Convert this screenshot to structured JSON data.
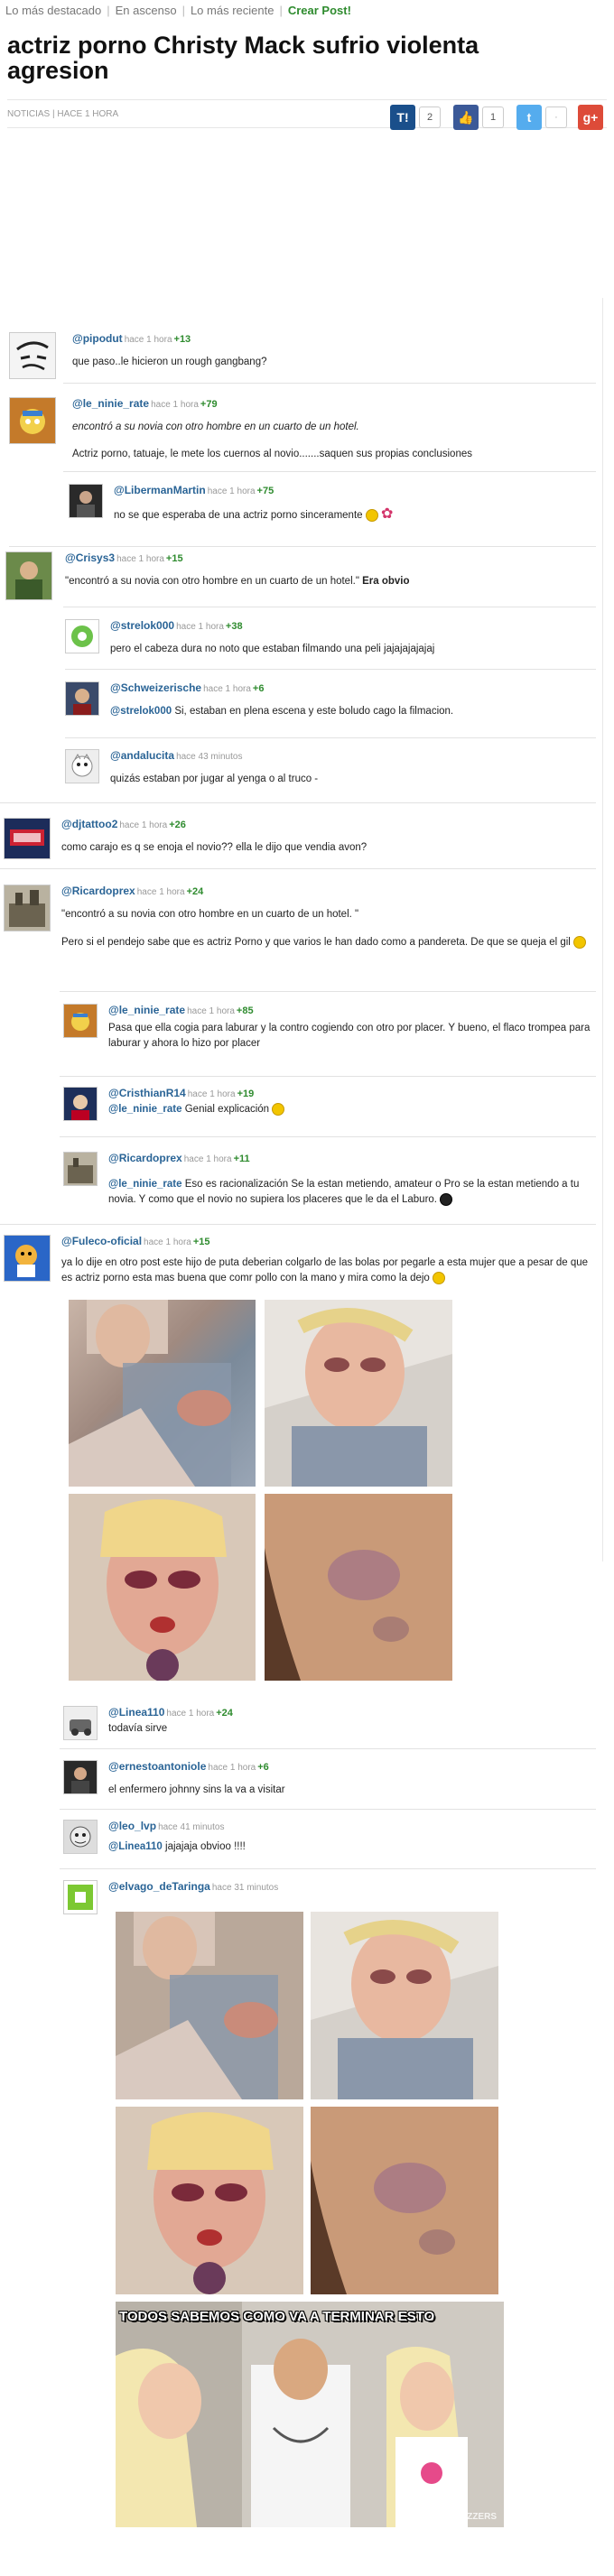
{
  "nav": {
    "item1": "Lo más destacado",
    "item2": "En ascenso",
    "item3": "Lo más reciente",
    "crear": "Crear Post!"
  },
  "post": {
    "title": "actriz porno Christy Mack sufrio violenta agresion",
    "meta": "NOTICIAS | HACE 1 HORA"
  },
  "share": {
    "taringa_count": "2",
    "like_count": "1"
  },
  "colors": {
    "link": "#2a6496",
    "votes": "#2e8b2e",
    "taringa": "#1a4f8b",
    "facebook": "#3b5998",
    "twitter": "#55acee",
    "gplus": "#dd4b39"
  },
  "comments": [
    {
      "user": "@pipodut",
      "time": "hace 1 hora",
      "votes": "+13",
      "text": "que paso..le hicieron un rough gangbang?"
    },
    {
      "user": "@le_ninie_rate",
      "time": "hace 1 hora",
      "votes": "+79",
      "text": "encontró a su novia con otro hombre en un cuarto de un hotel.",
      "text2": "Actriz porno, tatuaje, le mete los cuernos al novio.......saquen sus propias conclusiones"
    },
    {
      "user": "@LibermanMartin",
      "time": "hace 1 hora",
      "votes": "+75",
      "text": "no se que esperaba de una actriz porno sinceramente"
    },
    {
      "user": "@Crisys3",
      "time": "hace 1 hora",
      "votes": "+15",
      "text": "\"encontró a su novia con otro hombre en un cuarto de un hotel.\"",
      "bold": "Era obvio"
    },
    {
      "user": "@strelok000",
      "time": "hace 1 hora",
      "votes": "+38",
      "text": "pero el cabeza dura no noto que estaban filmando una peli jajajajajajaj"
    },
    {
      "user": "@Schweizerische",
      "time": "hace 1 hora",
      "votes": "+6",
      "reply": "@strelok000",
      "text": "Si, estaban en plena escena y este boludo cago la filmacion."
    },
    {
      "user": "@andalucita",
      "time": "hace 43 minutos",
      "votes": "",
      "text": "quizás estaban por jugar al yenga o al truco -"
    },
    {
      "user": "@djtattoo2",
      "time": "hace 1 hora",
      "votes": "+26",
      "text": "como carajo es q se enoja el novio?? ella le dijo que vendia avon?"
    },
    {
      "user": "@Ricardoprex",
      "time": "hace 1 hora",
      "votes": "+24",
      "text": "\"encontró a su novia con otro hombre en un cuarto de un hotel. \"",
      "text2": "Pero si el pendejo sabe que es actriz Porno y que varios le han dado como a pandereta. De que se queja el gil"
    },
    {
      "user": "@le_ninie_rate",
      "time": "hace 1 hora",
      "votes": "+85",
      "text": "Pasa que ella cogia para laburar y la contro cogiendo con otro por placer. Y bueno, el flaco trompea para laburar y ahora lo hizo por placer"
    },
    {
      "user": "@CristhianR14",
      "time": "hace 1 hora",
      "votes": "+19",
      "reply": "@le_ninie_rate",
      "text": "Genial explicación"
    },
    {
      "user": "@Ricardoprex",
      "time": "hace 1 hora",
      "votes": "+11",
      "reply": "@le_ninie_rate",
      "text": "Eso es racionalización   Se la estan metiendo, amateur o Pro se la estan metiendo a tu novia. Y como que el novio no supiera los placeres que le da el Laburo."
    },
    {
      "user": "@Fuleco-oficial",
      "time": "hace 1 hora",
      "votes": "+15",
      "text": "ya lo dije en otro post este hijo de puta deberian colgarlo de las bolas por pegarle a esta mujer que a pesar de que es actriz porno esta mas buena que comr pollo con la mano y mira como la dejo"
    },
    {
      "user": "@Linea110",
      "time": "hace 1 hora",
      "votes": "+24",
      "text": "todavía sirve"
    },
    {
      "user": "@ernestoantoniole",
      "time": "hace 1 hora",
      "votes": "+6",
      "text": "el enfermero johnny sins la va a visitar"
    },
    {
      "user": "@leo_lvp",
      "time": "hace 41 minutos",
      "votes": "",
      "reply": "@Linea110",
      "text": "jajajaja obvioo !!!!"
    },
    {
      "user": "@elvago_deTaringa",
      "time": "hace 31 minutos",
      "votes": "",
      "text": ""
    }
  ],
  "meme_caption": "TODOS SABEMOS COMO VA A TERMINAR ESTO",
  "watermark": "BRAZZERS"
}
